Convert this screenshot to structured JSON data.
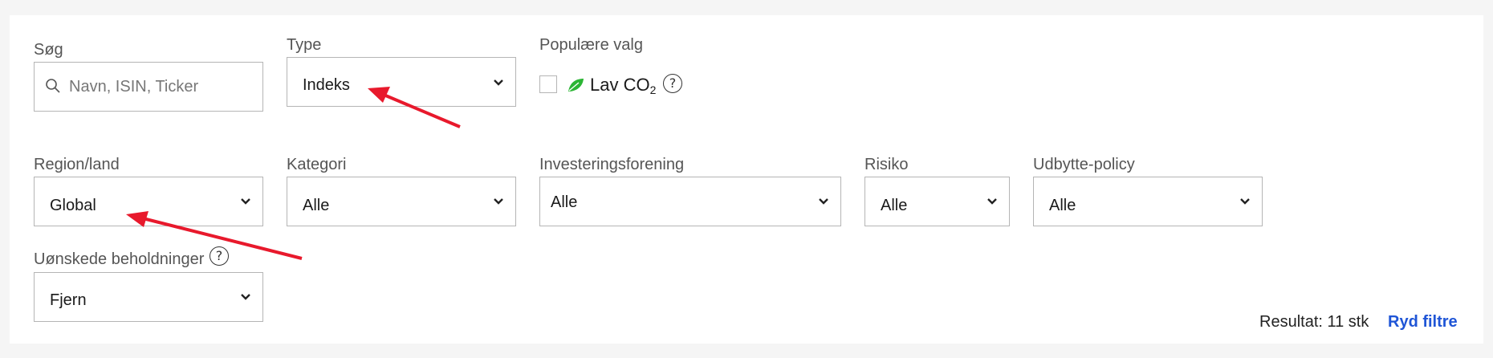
{
  "search": {
    "label": "Søg",
    "placeholder": "Navn, ISIN, Ticker"
  },
  "type": {
    "label": "Type",
    "value": "Indeks"
  },
  "popular": {
    "label": "Populære valg",
    "co2_text": "Lav CO",
    "co2_sub": "2",
    "checked": false
  },
  "region": {
    "label": "Region/land",
    "value": "Global"
  },
  "category": {
    "label": "Kategori",
    "value": "Alle"
  },
  "investment_association": {
    "label": "Investeringsforening",
    "value": "Alle"
  },
  "risk": {
    "label": "Risiko",
    "value": "Alle"
  },
  "dividend_policy": {
    "label": "Udbytte-policy",
    "value": "Alle"
  },
  "unwanted_holdings": {
    "label": "Uønskede beholdninger",
    "value": "Fjern"
  },
  "footer": {
    "result": "Resultat: 11 stk",
    "clear": "Ryd filtre"
  },
  "colors": {
    "accent_link": "#1f55d6",
    "arrow": "#e8192c",
    "leaf": "#2bb534"
  }
}
